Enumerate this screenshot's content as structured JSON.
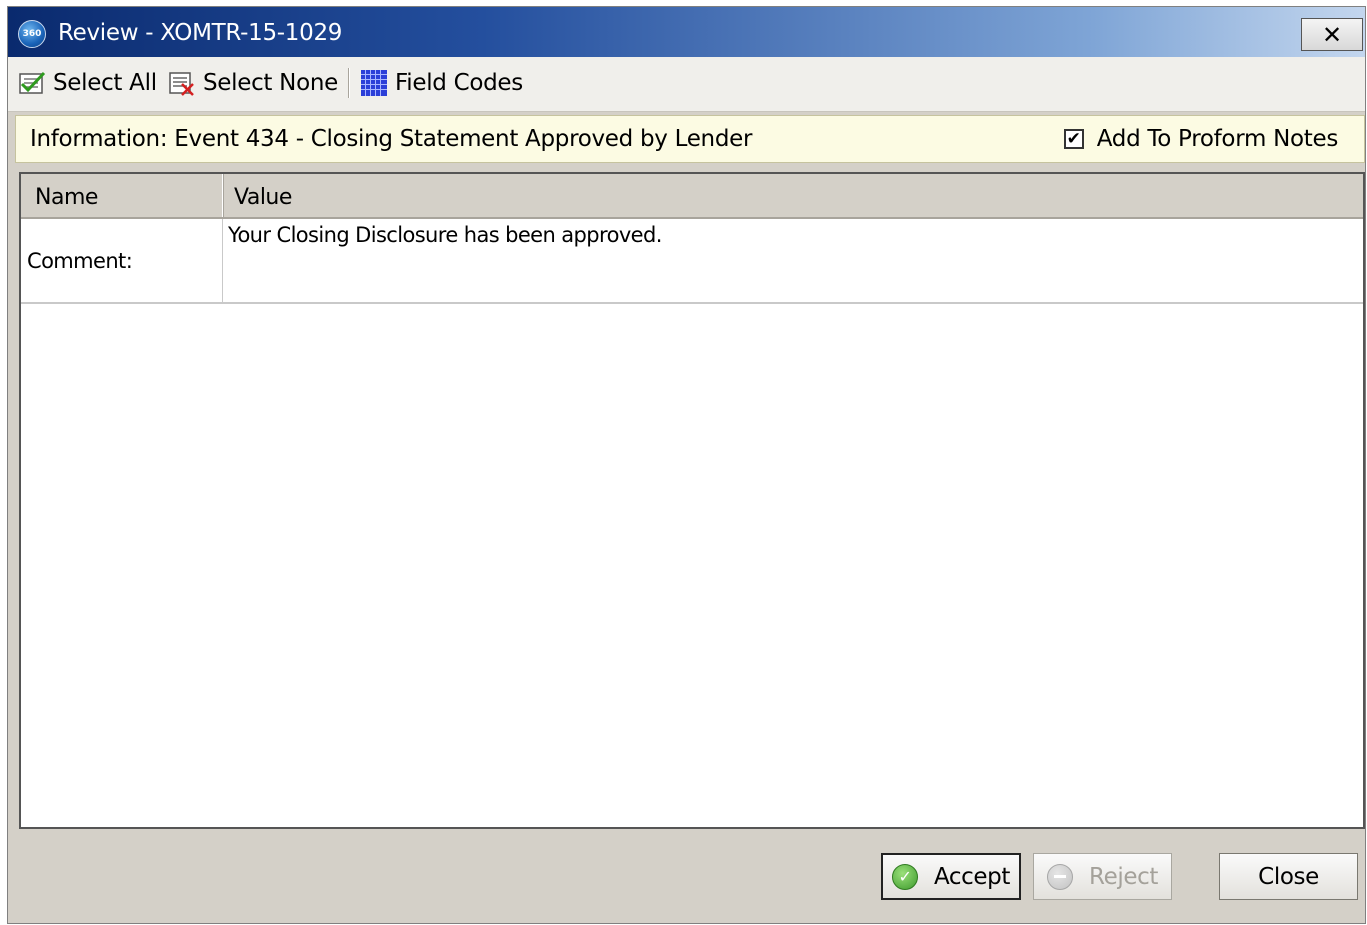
{
  "window": {
    "title": "Review - XOMTR-15-1029",
    "logo_text": "360",
    "close_glyph": "✕"
  },
  "toolbar": {
    "select_all": "Select All",
    "select_none": "Select None",
    "field_codes": "Field Codes"
  },
  "info": {
    "text": "Information: Event 434 - Closing Statement Approved by Lender",
    "add_to_proform_label": "Add To Proform Notes",
    "add_to_proform_checked": true,
    "check_glyph": "✔"
  },
  "grid": {
    "headers": {
      "name": "Name",
      "value": "Value"
    },
    "rows": [
      {
        "name": "Comment:",
        "value": "Your Closing Disclosure has been approved."
      }
    ]
  },
  "buttons": {
    "accept": "Accept",
    "reject": "Reject",
    "close": "Close",
    "accept_glyph": "✓"
  },
  "colors": {
    "title_gradient_start": "#0a2a6e",
    "title_gradient_end": "#c3d6ee",
    "info_background": "#fcfbe3",
    "window_background": "#d4d0c8"
  },
  "icons": {
    "select_all": "checklist-icon",
    "select_none": "clear-list-icon",
    "field_codes": "grid-codes-icon",
    "accept": "check-circle-icon",
    "reject": "minus-circle-icon"
  }
}
